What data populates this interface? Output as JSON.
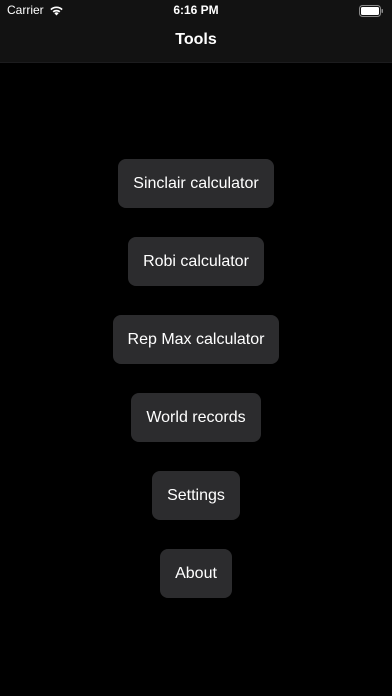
{
  "status_bar": {
    "carrier": "Carrier",
    "time": "6:16 PM",
    "icons": [
      "wifi-icon",
      "battery-icon"
    ]
  },
  "nav": {
    "title": "Tools"
  },
  "menu": {
    "items": [
      {
        "label": "Sinclair calculator"
      },
      {
        "label": "Robi calculator"
      },
      {
        "label": "Rep Max calculator"
      },
      {
        "label": "World records"
      },
      {
        "label": "Settings"
      },
      {
        "label": "About"
      }
    ]
  },
  "colors": {
    "background": "#000000",
    "nav_background": "#121212",
    "button_background": "#2c2c2e",
    "text": "#ffffff"
  }
}
